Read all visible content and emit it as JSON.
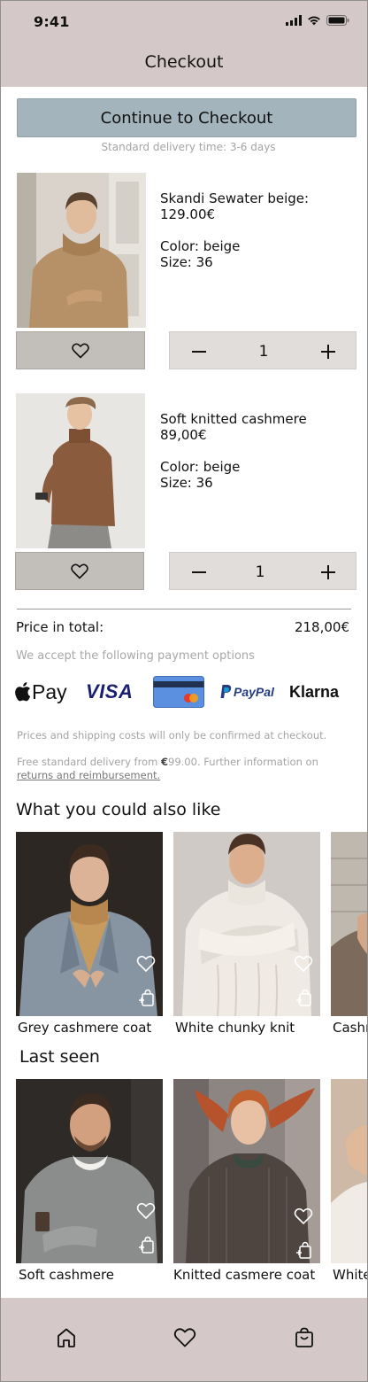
{
  "status_bar": {
    "time": "9:41"
  },
  "header": {
    "title": "Checkout"
  },
  "checkout": {
    "button_label": "Continue to Checkout",
    "delivery_note": "Standard delivery time: 3-6 days"
  },
  "cart": [
    {
      "name": "Skandi Sewater beige:",
      "price": "129.00€",
      "color": "Color: beige",
      "size": "Size: 36",
      "quantity": "1"
    },
    {
      "name": "Soft knitted cashmere",
      "price": "89,00€",
      "color": "Color: beige",
      "size": "Size: 36",
      "quantity": "1"
    }
  ],
  "summary": {
    "total_label": "Price in total:",
    "total_value": "218,00€",
    "payment_note": "We accept the following payment options",
    "payment_methods": [
      "Pay",
      "VISA",
      "PayPal",
      "Klarna"
    ],
    "confirm_note": "Prices and shipping costs will only be confirmed at checkout.",
    "free_delivery_prefix": "Free standard delivery from ",
    "free_delivery_amount": "€",
    "free_delivery_amount_value": "99.00",
    "free_delivery_suffix": ". Further information on",
    "returns_link": "returns and reimbursement."
  },
  "recommendations": {
    "title": "What you could also like",
    "items": [
      "Grey cashmere coat",
      "White chunky knit",
      "Cashmere"
    ]
  },
  "last_seen": {
    "title": "Last seen",
    "items": [
      "Soft cashmere",
      "Knitted casmere coat",
      "White"
    ]
  },
  "colors": {
    "header_bg": "#d5c8c8",
    "checkout_button": "#a3b4bc",
    "fav_button": "#c2bfba",
    "qty_box": "#e0ddda"
  },
  "icons": [
    "signal-icon",
    "wifi-icon",
    "battery-icon",
    "heart-icon",
    "minus-icon",
    "plus-icon",
    "add-to-bag-icon",
    "home-icon",
    "bag-icon"
  ]
}
